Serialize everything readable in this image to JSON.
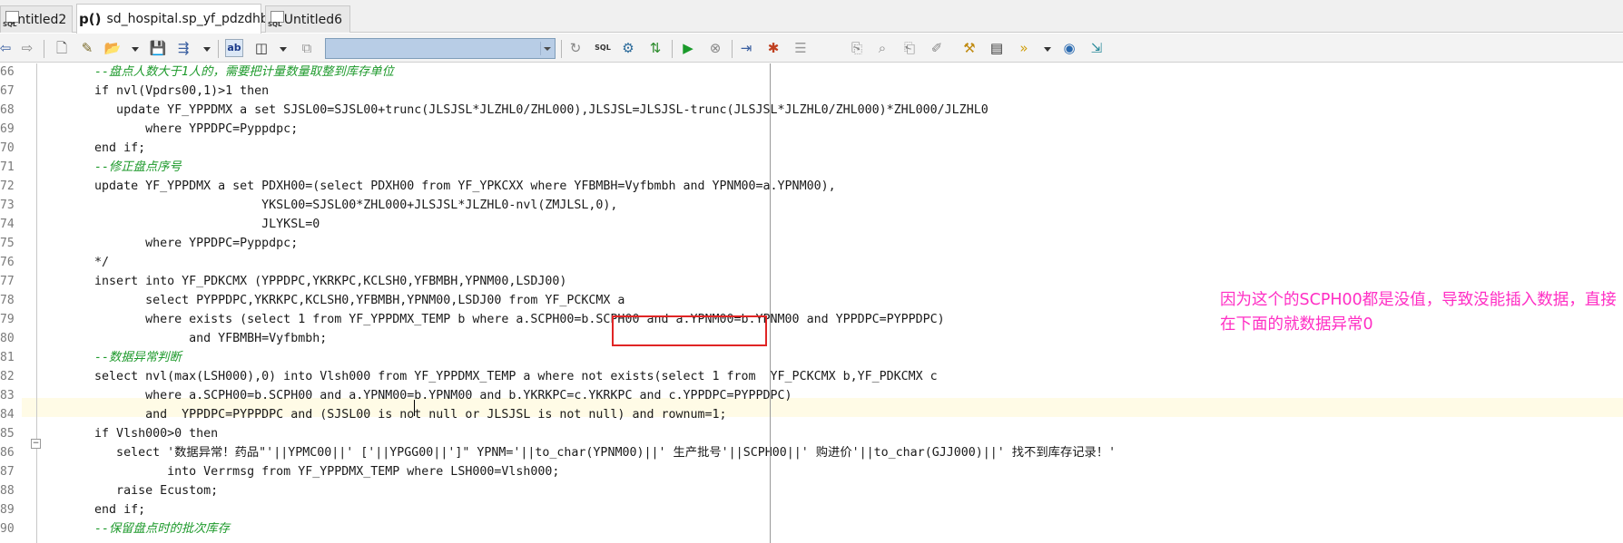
{
  "tabs": [
    {
      "label": "Untitled2",
      "icon": "sql-file-icon"
    },
    {
      "label": "sd_hospital.sp_yf_pdzdhb",
      "icon": "procedure-icon",
      "icon_text": "p()",
      "active": true
    },
    {
      "label": "Untitled6",
      "icon": "sql-file-icon"
    }
  ],
  "toolbar": {
    "combo_value": "",
    "buttons": [
      "back-arrow-icon",
      "forward-arrow-icon",
      "new-file-icon",
      "new-object-icon",
      "open-folder-icon",
      "save-icon",
      "execute-menu-icon",
      "autocomplete-icon",
      "layout-icon",
      "refresh-icon",
      "sql-icon",
      "explain-icon",
      "compile-icon",
      "run-icon",
      "stop-icon",
      "step-icon",
      "debug-icon",
      "list-icon",
      "copy-icon",
      "find-icon",
      "paste-icon",
      "edit-icon",
      "tools-icon",
      "chart-icon",
      "forward-all-icon",
      "help-icon",
      "export-icon"
    ]
  },
  "editor": {
    "accent_colors": {
      "comment": "#1e9a2c",
      "keyword": "#0000ff",
      "annotation": "#ff2ec4",
      "highlight_box": "#e02525"
    },
    "annotation": "因为这个的SCPH00都是没值，导致没能插入数据，直接在下面的就数据异常0",
    "lines": [
      {
        "n": "66",
        "t": "        --盘点人数大于1人的，需要把计量数量取整到库存单位"
      },
      {
        "n": "67",
        "t": "        if nvl(Vpdrs00,1)>1 then"
      },
      {
        "n": "68",
        "t": "           update YF_YPPDMX a set SJSL00=SJSL00+trunc(JLSJSL*JLZHL0/ZHL000),JLSJSL=JLSJSL-trunc(JLSJSL*JLZHL0/ZHL000)*ZHL000/JLZHL0"
      },
      {
        "n": "69",
        "t": "               where YPPDPC=Pyppdpc;"
      },
      {
        "n": "70",
        "t": "        end if;"
      },
      {
        "n": "71",
        "t": "        --修正盘点序号"
      },
      {
        "n": "72",
        "t": "        update YF_YPPDMX a set PDXH00=(select PDXH00 from YF_YPKCXX where YFBMBH=Vyfbmbh and YPNM00=a.YPNM00),"
      },
      {
        "n": "73",
        "t": "                               YKSL00=SJSL00*ZHL000+JLSJSL*JLZHL0-nvl(ZMJLSL,0),"
      },
      {
        "n": "74",
        "t": "                               JLYKSL=0"
      },
      {
        "n": "75",
        "t": "               where YPPDPC=Pyppdpc;"
      },
      {
        "n": "76",
        "t": "        */"
      },
      {
        "n": "77",
        "t": "        insert into YF_PDKCMX (YPPDPC,YKRKPC,KCLSH0,YFBMBH,YPNM00,LSDJ00)"
      },
      {
        "n": "78",
        "t": "               select PYPPDPC,YKRKPC,KCLSH0,YFBMBH,YPNM00,LSDJ00 from YF_PCKCMX a"
      },
      {
        "n": "79",
        "t": "               where exists (select 1 from YF_YPPDMX_TEMP b where a.SCPH00=b.SCPH00 and a.YPNM00=b.YPNM00 and YPPDPC=PYPPDPC)"
      },
      {
        "n": "80",
        "t": "                     and YFBMBH=Vyfbmbh;"
      },
      {
        "n": "81",
        "t": "        --数据异常判断"
      },
      {
        "n": "82",
        "t": "        select nvl(max(LSH000),0) into Vlsh000 from YF_YPPDMX_TEMP a where not exists(select 1 from  YF_PCKCMX b,YF_PDKCMX c"
      },
      {
        "n": "83",
        "t": "               where a.SCPH00=b.SCPH00 and a.YPNM00=b.YPNM00 and b.YKRKPC=c.YKRKPC and c.YPPDPC=PYPPDPC)"
      },
      {
        "n": "84",
        "t": "               and  YPPDPC=PYPPDPC and (SJSL00 is not null or JLSJSL is not null) and rownum=1;"
      },
      {
        "n": "85",
        "t": "        if Vlsh000>0 then"
      },
      {
        "n": "86",
        "t": "           select '数据异常！药品\"'||YPMC00||' ['||YPGG00||']\" YPNM='||to_char(YPNM00)||' 生产批号'||SCPH00||' 购进价'||to_char(GJJ000)||' 找不到库存记录！'"
      },
      {
        "n": "87",
        "t": "                  into Verrmsg from YF_YPPDMX_TEMP where LSH000=Vlsh000;"
      },
      {
        "n": "88",
        "t": "           raise Ecustom;"
      },
      {
        "n": "89",
        "t": "        end if;"
      },
      {
        "n": "90",
        "t": "        --保留盘点时的批次库存"
      }
    ]
  }
}
